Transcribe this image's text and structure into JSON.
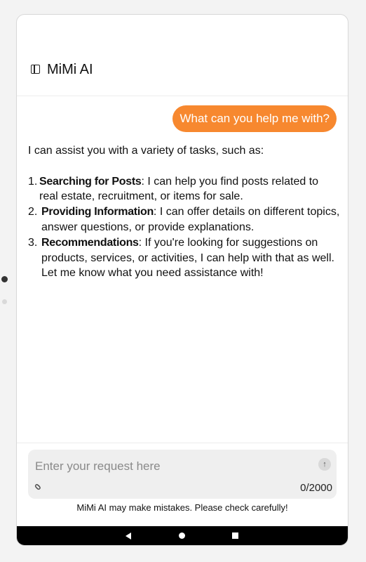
{
  "header": {
    "title": "MiMi AI",
    "sidebar_icon": "sidebar-book-icon"
  },
  "chat": {
    "user_message": "What can you help me with?",
    "reply": {
      "intro": "I can assist you with a variety of tasks, such as:",
      "items": [
        {
          "num": "1.",
          "title": "Searching for Posts",
          "text": ": I can help you find posts related to real estate, recruitment, or items for sale."
        },
        {
          "num": "2.",
          "title": "Providing Information",
          "text": ": I can offer details on different topics, answer questions, or provide explanations."
        },
        {
          "num": "3.",
          "title": "Recommendations",
          "text": ": If you're looking for suggestions on products, services, or activities, I can help with that as well. Let me know what you need assistance with!"
        }
      ]
    }
  },
  "composer": {
    "placeholder": "Enter your request here",
    "counter": "0/2000",
    "send_icon": "arrow-up-icon",
    "attach_icon": "paperclip-icon"
  },
  "disclaimer": "MiMi AI may make mistakes. Please check carefully!",
  "colors": {
    "accent": "#f7882f"
  }
}
